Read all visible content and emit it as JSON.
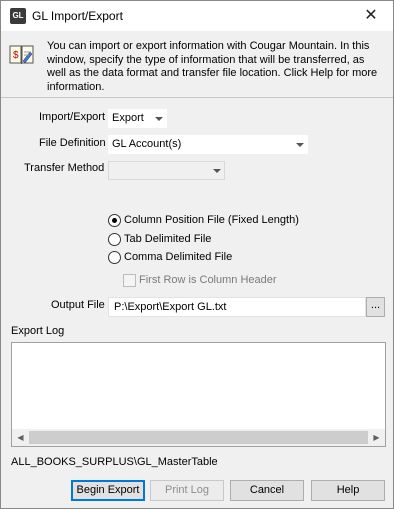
{
  "window": {
    "title": "GL Import/Export",
    "app_icon_text": "GL",
    "close_glyph": "✕"
  },
  "info": {
    "icon": "book-dollar-icon",
    "text": "You can import or export information with Cougar Mountain. In this window, specify the type of information that will be transferred, as well as the data format and transfer file location. Click Help for more information."
  },
  "form": {
    "import_export_label": "Import/Export",
    "import_export_value": "Export",
    "file_definition_label": "File Definition",
    "file_definition_value": "GL Account(s)",
    "transfer_method_label": "Transfer Method",
    "transfer_method_value": "",
    "radios": [
      {
        "label": "Column Position File (Fixed Length)",
        "selected": true
      },
      {
        "label": "Tab Delimited File",
        "selected": false
      },
      {
        "label": "Comma Delimited File",
        "selected": false
      }
    ],
    "first_row_header_label": "First Row is Column Header",
    "first_row_header_checked": false,
    "output_file_label": "Output File",
    "output_file_value": "P:\\Export\\Export GL.txt",
    "browse_label": "..."
  },
  "export_log": {
    "label": "Export Log"
  },
  "status_path": "ALL_BOOKS_SURPLUS\\GL_MasterTable",
  "buttons": {
    "begin_export": "Begin Export",
    "print_log": "Print Log",
    "cancel": "Cancel",
    "help": "Help"
  }
}
